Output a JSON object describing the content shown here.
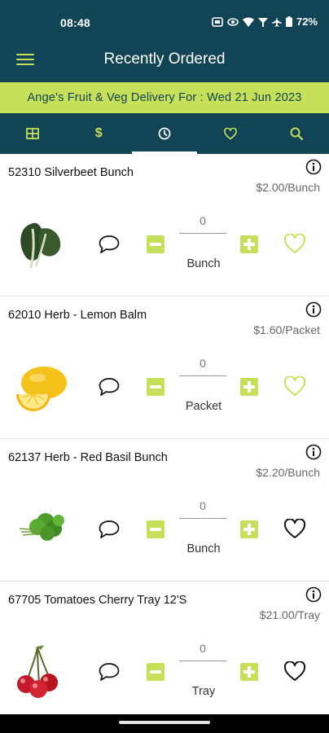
{
  "status": {
    "time": "08:48",
    "battery": "72%"
  },
  "header": {
    "title": "Recently Ordered"
  },
  "banner": {
    "text": "Ange's Fruit & Veg Delivery For : Wed 21 Jun 2023"
  },
  "tabs": [
    {
      "icon": "grid-icon",
      "active": false
    },
    {
      "icon": "dollar-icon",
      "label": "$",
      "active": false
    },
    {
      "icon": "clock-icon",
      "active": true
    },
    {
      "icon": "heart-icon",
      "active": false
    },
    {
      "icon": "search-icon",
      "active": false
    }
  ],
  "products": [
    {
      "name": "52310 Silverbeet Bunch",
      "price": "$2.00/Bunch",
      "qty": "0",
      "unit": "Bunch",
      "favorite": true,
      "image": "silverbeet-image"
    },
    {
      "name": "62010 Herb - Lemon Balm",
      "price": "$1.60/Packet",
      "qty": "0",
      "unit": "Packet",
      "favorite": true,
      "image": "lemon-image"
    },
    {
      "name": "62137 Herb - Red Basil Bunch",
      "price": "$2.20/Bunch",
      "qty": "0",
      "unit": "Bunch",
      "favorite": false,
      "image": "herb-bunch-image"
    },
    {
      "name": "67705 Tomatoes Cherry Tray 12'S",
      "price": "$21.00/Tray",
      "qty": "0",
      "unit": "Tray",
      "favorite": false,
      "image": "cherries-image"
    }
  ],
  "colors": {
    "primary": "#114454",
    "accent": "#c6e05a"
  }
}
